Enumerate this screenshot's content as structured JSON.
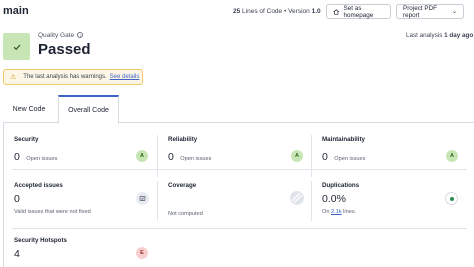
{
  "header": {
    "branch": "main",
    "loc_value": "25",
    "loc_label": "Lines of Code",
    "version_label": "Version",
    "version_value": "1.0",
    "set_homepage_label": "Set as homepage",
    "pdf_report_label": "Project PDF report"
  },
  "quality_gate": {
    "label": "Quality Gate",
    "status": "Passed",
    "status_color": "#c8e5b5",
    "last_analysis_label": "Last analysis",
    "last_analysis_value": "1 day ago"
  },
  "warning": {
    "text": "The last analysis has warnings.",
    "link": "See details"
  },
  "tabs": [
    {
      "label": "New Code",
      "active": false
    },
    {
      "label": "Overall Code",
      "active": true
    }
  ],
  "metrics": {
    "security": {
      "title": "Security",
      "value": "0",
      "sub": "Open issues",
      "grade": "A"
    },
    "reliability": {
      "title": "Reliability",
      "value": "0",
      "sub": "Open issues",
      "grade": "A"
    },
    "maintainability": {
      "title": "Maintainability",
      "value": "0",
      "sub": "Open issues",
      "grade": "A"
    },
    "accepted": {
      "title": "Accepted issues",
      "value": "0",
      "sub": "Valid issues that were not fixed"
    },
    "coverage": {
      "title": "Coverage",
      "sub": "Not computed"
    },
    "duplications": {
      "title": "Duplications",
      "value": "0.0%",
      "sub_prefix": "On",
      "sub_lines": "2.1k",
      "sub_suffix": "lines."
    },
    "hotspots": {
      "title": "Security Hotspots",
      "value": "4",
      "grade": "E"
    }
  },
  "colors": {
    "accent": "#3f63c7",
    "grade_a": "#c8e5b5",
    "grade_e": "#f8cfcf",
    "warning_border": "#f0c86a"
  }
}
